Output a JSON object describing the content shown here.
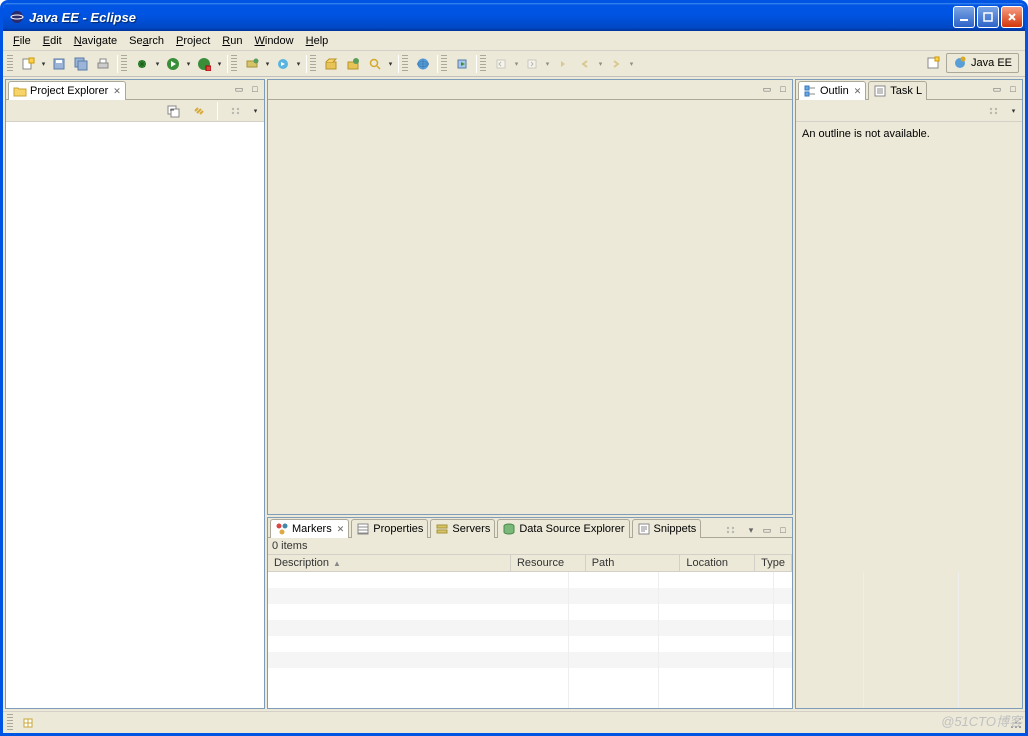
{
  "title": "Java EE - Eclipse",
  "menu": [
    "File",
    "Edit",
    "Navigate",
    "Search",
    "Project",
    "Run",
    "Window",
    "Help"
  ],
  "perspective": {
    "label": "Java EE"
  },
  "left": {
    "tab_label": "Project Explorer"
  },
  "outline": {
    "tab1": "Outlin",
    "tab2": "Task L",
    "body_text": "An outline is not available."
  },
  "bottom": {
    "tabs": [
      "Markers",
      "Properties",
      "Servers",
      "Data Source Explorer",
      "Snippets"
    ],
    "count_text": "0 items",
    "columns": {
      "description": "Description",
      "resource": "Resource",
      "path": "Path",
      "location": "Location",
      "type": "Type"
    }
  },
  "watermark": "@51CTO博客"
}
